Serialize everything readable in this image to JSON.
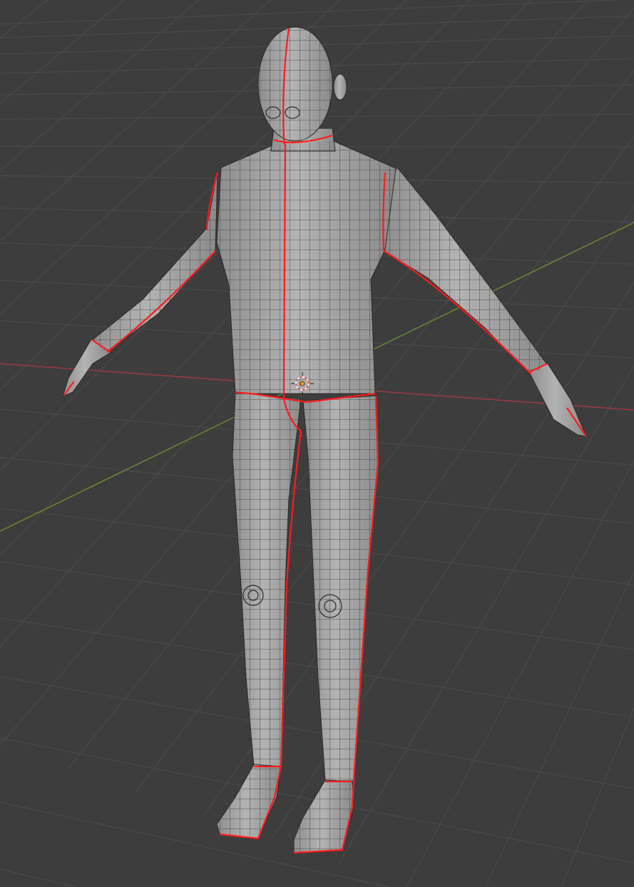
{
  "viewport": {
    "background_color": "#3d3d3d",
    "grid_color": "#4b4b4b",
    "x_axis_color": "#9a3a3f",
    "y_axis_color": "#6a8a2e"
  },
  "mesh": {
    "name_icon": "human-base-mesh",
    "surface_color": "#a3a3a3",
    "wire_color": "#2a2a2a",
    "seam_color": "#ff1a1a"
  },
  "cursor": {
    "icon": "3d-cursor-icon",
    "color": "#ff6a00"
  }
}
